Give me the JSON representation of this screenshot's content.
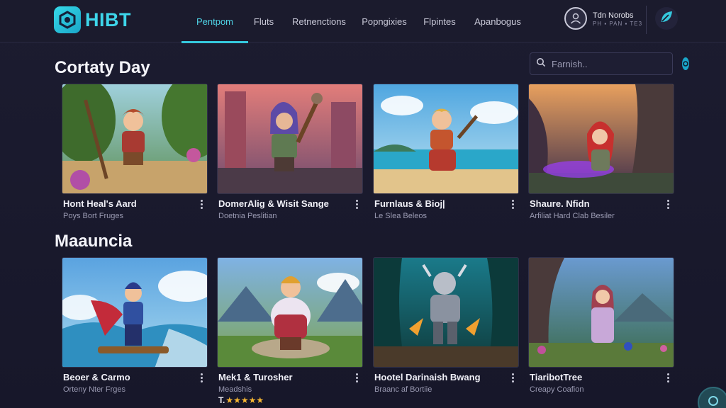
{
  "brand": {
    "name": "HIBT"
  },
  "nav": {
    "tabs": [
      {
        "label": "Pentpom",
        "active": true
      },
      {
        "label": "Fluts",
        "active": false
      },
      {
        "label": "Retnenctions",
        "active": false
      },
      {
        "label": "Popngixies",
        "active": false
      },
      {
        "label": "Flpintes",
        "active": false
      },
      {
        "label": "Apanbogus",
        "active": false
      }
    ]
  },
  "user": {
    "name": "Tdn Norobs",
    "subtitle": "PH ▪ PAN ▪ TE3"
  },
  "search": {
    "placeholder": "Farnish.."
  },
  "sections": [
    {
      "title": "Cortaty Day",
      "cards": [
        {
          "title": "Hont Heal's Aard",
          "subtitle": "Poys Bort Fruges"
        },
        {
          "title": "DomerAlig & Wisit Sange",
          "subtitle": "Doetnia Peslitian"
        },
        {
          "title": "Furnlaus & Bioj|",
          "subtitle": "Le Slea Beleos"
        },
        {
          "title": "Shaure. Nfidn",
          "subtitle": "Arfiliat Hard Clab Besiler"
        }
      ]
    },
    {
      "title": "Maauncia",
      "cards": [
        {
          "title": "Beoer & Carmo",
          "subtitle": "Orteny Nter Frges"
        },
        {
          "title": "Mek1 & Turosher",
          "subtitle": "Meadshis",
          "rating_prefix": "T.",
          "stars": 5
        },
        {
          "title": "Hootel Darinaish Bwang",
          "subtitle": "Braanc af Bortiie"
        },
        {
          "title": "TiaribotTree",
          "subtitle": "Creapy Coafion"
        }
      ]
    }
  ],
  "colors": {
    "accent": "#35c8dd",
    "star": "#f7b733",
    "background": "#1a1a2e"
  },
  "icons": {
    "logo": "hexagon-logo-icon",
    "search": "search-icon",
    "search_go": "circle-target-icon",
    "avatar": "user-avatar-icon",
    "quick": "leaf-icon",
    "more": "more-vertical-icon"
  }
}
